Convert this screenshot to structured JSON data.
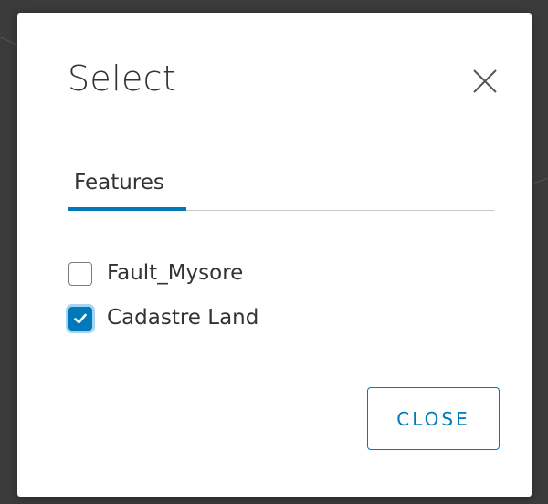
{
  "dialog": {
    "title": "Select",
    "close_icon": "close-icon",
    "tabs": [
      {
        "label": "Features",
        "active": true
      }
    ],
    "options": [
      {
        "label": "Fault_Mysore",
        "checked": false
      },
      {
        "label": "Cadastre Land",
        "checked": true
      }
    ],
    "close_button_label": "CLOSE"
  },
  "colors": {
    "accent": "#0079b8",
    "text": "#333333",
    "backdrop": "#3b3b3b",
    "dialog_bg": "#ffffff"
  }
}
